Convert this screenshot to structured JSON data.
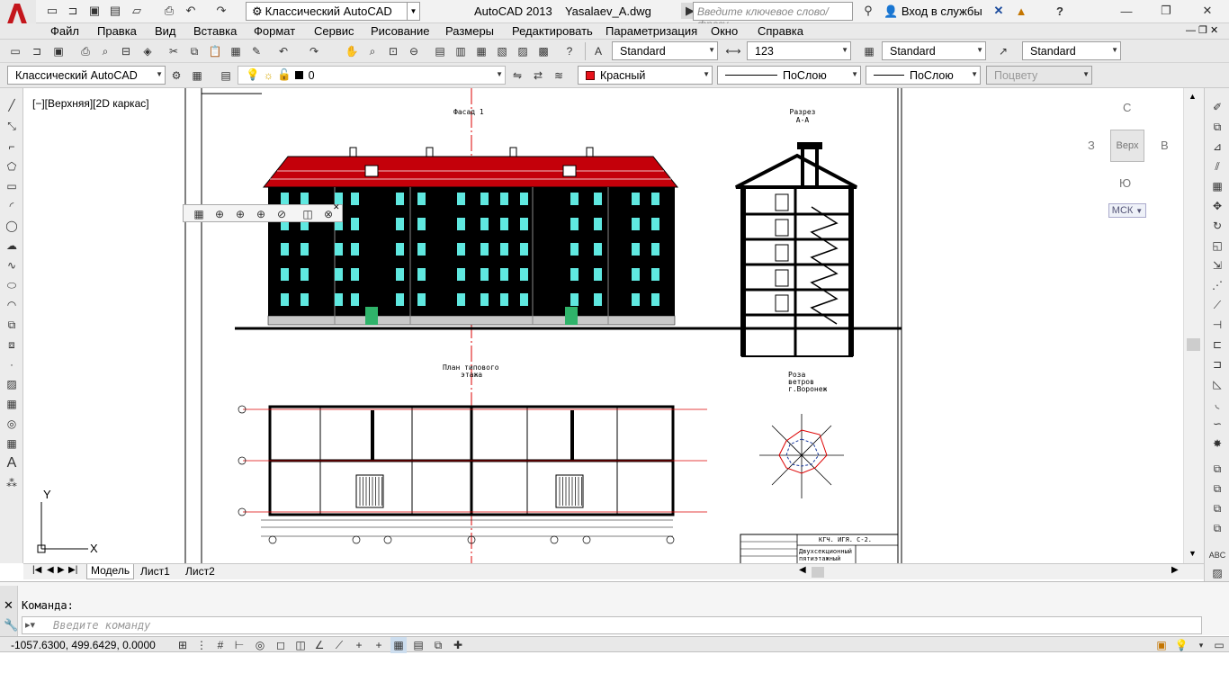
{
  "titlebar": {
    "workspace": "Классический AutoCAD",
    "app_title": "AutoCAD 2013",
    "file_name": "Yasalaev_A.dwg",
    "search_placeholder": "Введите ключевое слово/фразу",
    "login_label": "Вход в службы"
  },
  "menus": [
    "Файл",
    "Правка",
    "Вид",
    "Вставка",
    "Формат",
    "Сервис",
    "Рисование",
    "Размеры",
    "Редактировать",
    "Параметризация",
    "Окно",
    "Справка"
  ],
  "styles_toolbar": {
    "text_style": "Standard",
    "dim_style": "123",
    "table_style": "Standard",
    "mleader_style": "Standard"
  },
  "layers_toolbar": {
    "workspace": "Классический AutoCAD",
    "layer": "0",
    "color": "Красный",
    "color_hex": "#e8121b",
    "linetype": "ПоСлою",
    "lineweight": "ПоСлою",
    "plotstyle": "Поцвету"
  },
  "viewport": {
    "label": "[−][Верхняя][2D каркас]",
    "viewcube": {
      "top": "С",
      "bottom": "Ю",
      "left": "З",
      "right": "В",
      "face": "Верх"
    },
    "ucs": "МСК"
  },
  "drawing": {
    "facade_title": "Фасад 1",
    "section_title": "Разрез А-А",
    "plan_title_1": "План типового",
    "plan_title_2": "этажа",
    "wind_title_1": "Роза",
    "wind_title_2": "ветров",
    "wind_title_3": "г.Воронеж",
    "stamp_1": "КГЧ. ИГЯ. С-2.",
    "stamp_2": "Двухсекционный",
    "stamp_3": "пятиэтажный",
    "roof_color": "#c4000a",
    "wall_color": "#000000",
    "window_color": "#5fe8e0",
    "door_color": "#2fb36a"
  },
  "layout_tabs": [
    "Модель",
    "Лист1",
    "Лист2"
  ],
  "command": {
    "history": "Команда:",
    "placeholder": "Введите команду"
  },
  "status": {
    "coordinates": "-1057.6300, 499.6429, 0.0000"
  }
}
